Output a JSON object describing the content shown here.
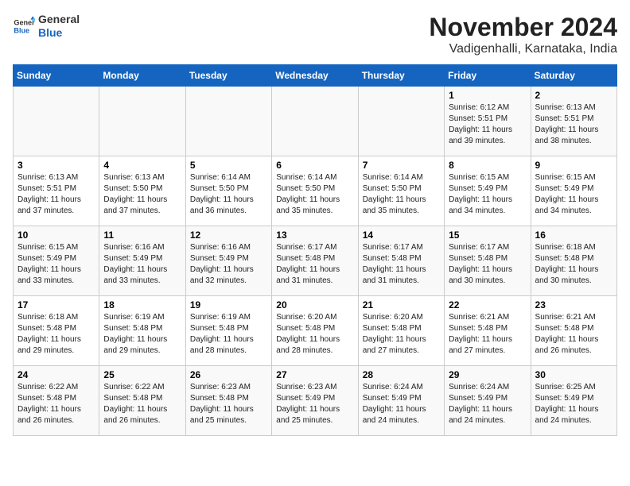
{
  "logo": {
    "text_general": "General",
    "text_blue": "Blue"
  },
  "title": "November 2024",
  "location": "Vadigenhalli, Karnataka, India",
  "days_header": [
    "Sunday",
    "Monday",
    "Tuesday",
    "Wednesday",
    "Thursday",
    "Friday",
    "Saturday"
  ],
  "weeks": [
    {
      "cells": [
        {
          "day": "",
          "content": ""
        },
        {
          "day": "",
          "content": ""
        },
        {
          "day": "",
          "content": ""
        },
        {
          "day": "",
          "content": ""
        },
        {
          "day": "",
          "content": ""
        },
        {
          "day": "1",
          "content": "Sunrise: 6:12 AM\nSunset: 5:51 PM\nDaylight: 11 hours and 39 minutes."
        },
        {
          "day": "2",
          "content": "Sunrise: 6:13 AM\nSunset: 5:51 PM\nDaylight: 11 hours and 38 minutes."
        }
      ]
    },
    {
      "cells": [
        {
          "day": "3",
          "content": "Sunrise: 6:13 AM\nSunset: 5:51 PM\nDaylight: 11 hours and 37 minutes."
        },
        {
          "day": "4",
          "content": "Sunrise: 6:13 AM\nSunset: 5:50 PM\nDaylight: 11 hours and 37 minutes."
        },
        {
          "day": "5",
          "content": "Sunrise: 6:14 AM\nSunset: 5:50 PM\nDaylight: 11 hours and 36 minutes."
        },
        {
          "day": "6",
          "content": "Sunrise: 6:14 AM\nSunset: 5:50 PM\nDaylight: 11 hours and 35 minutes."
        },
        {
          "day": "7",
          "content": "Sunrise: 6:14 AM\nSunset: 5:50 PM\nDaylight: 11 hours and 35 minutes."
        },
        {
          "day": "8",
          "content": "Sunrise: 6:15 AM\nSunset: 5:49 PM\nDaylight: 11 hours and 34 minutes."
        },
        {
          "day": "9",
          "content": "Sunrise: 6:15 AM\nSunset: 5:49 PM\nDaylight: 11 hours and 34 minutes."
        }
      ]
    },
    {
      "cells": [
        {
          "day": "10",
          "content": "Sunrise: 6:15 AM\nSunset: 5:49 PM\nDaylight: 11 hours and 33 minutes."
        },
        {
          "day": "11",
          "content": "Sunrise: 6:16 AM\nSunset: 5:49 PM\nDaylight: 11 hours and 33 minutes."
        },
        {
          "day": "12",
          "content": "Sunrise: 6:16 AM\nSunset: 5:49 PM\nDaylight: 11 hours and 32 minutes."
        },
        {
          "day": "13",
          "content": "Sunrise: 6:17 AM\nSunset: 5:48 PM\nDaylight: 11 hours and 31 minutes."
        },
        {
          "day": "14",
          "content": "Sunrise: 6:17 AM\nSunset: 5:48 PM\nDaylight: 11 hours and 31 minutes."
        },
        {
          "day": "15",
          "content": "Sunrise: 6:17 AM\nSunset: 5:48 PM\nDaylight: 11 hours and 30 minutes."
        },
        {
          "day": "16",
          "content": "Sunrise: 6:18 AM\nSunset: 5:48 PM\nDaylight: 11 hours and 30 minutes."
        }
      ]
    },
    {
      "cells": [
        {
          "day": "17",
          "content": "Sunrise: 6:18 AM\nSunset: 5:48 PM\nDaylight: 11 hours and 29 minutes."
        },
        {
          "day": "18",
          "content": "Sunrise: 6:19 AM\nSunset: 5:48 PM\nDaylight: 11 hours and 29 minutes."
        },
        {
          "day": "19",
          "content": "Sunrise: 6:19 AM\nSunset: 5:48 PM\nDaylight: 11 hours and 28 minutes."
        },
        {
          "day": "20",
          "content": "Sunrise: 6:20 AM\nSunset: 5:48 PM\nDaylight: 11 hours and 28 minutes."
        },
        {
          "day": "21",
          "content": "Sunrise: 6:20 AM\nSunset: 5:48 PM\nDaylight: 11 hours and 27 minutes."
        },
        {
          "day": "22",
          "content": "Sunrise: 6:21 AM\nSunset: 5:48 PM\nDaylight: 11 hours and 27 minutes."
        },
        {
          "day": "23",
          "content": "Sunrise: 6:21 AM\nSunset: 5:48 PM\nDaylight: 11 hours and 26 minutes."
        }
      ]
    },
    {
      "cells": [
        {
          "day": "24",
          "content": "Sunrise: 6:22 AM\nSunset: 5:48 PM\nDaylight: 11 hours and 26 minutes."
        },
        {
          "day": "25",
          "content": "Sunrise: 6:22 AM\nSunset: 5:48 PM\nDaylight: 11 hours and 26 minutes."
        },
        {
          "day": "26",
          "content": "Sunrise: 6:23 AM\nSunset: 5:48 PM\nDaylight: 11 hours and 25 minutes."
        },
        {
          "day": "27",
          "content": "Sunrise: 6:23 AM\nSunset: 5:49 PM\nDaylight: 11 hours and 25 minutes."
        },
        {
          "day": "28",
          "content": "Sunrise: 6:24 AM\nSunset: 5:49 PM\nDaylight: 11 hours and 24 minutes."
        },
        {
          "day": "29",
          "content": "Sunrise: 6:24 AM\nSunset: 5:49 PM\nDaylight: 11 hours and 24 minutes."
        },
        {
          "day": "30",
          "content": "Sunrise: 6:25 AM\nSunset: 5:49 PM\nDaylight: 11 hours and 24 minutes."
        }
      ]
    }
  ]
}
